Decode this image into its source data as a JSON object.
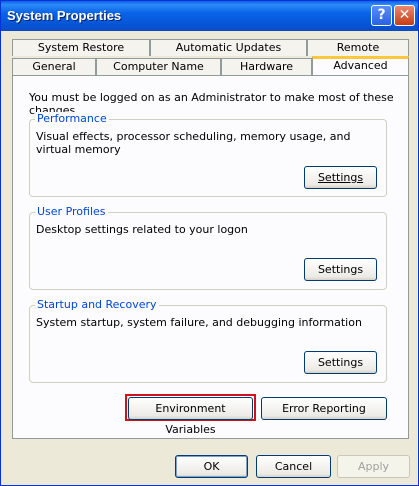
{
  "window": {
    "title": "System Properties",
    "help_glyph": "?",
    "close_glyph": "✕"
  },
  "tabs": {
    "row_back": [
      "System Restore",
      "Automatic Updates",
      "Remote"
    ],
    "row_front": [
      "General",
      "Computer Name",
      "Hardware",
      "Advanced"
    ],
    "active": "Advanced"
  },
  "content": {
    "notice": "You must be logged on as an Administrator to make most of these changes.",
    "groups": [
      {
        "title": "Performance",
        "description": "Visual effects, processor scheduling, memory usage, and virtual memory",
        "button": "Settings"
      },
      {
        "title": "User Profiles",
        "description": "Desktop settings related to your logon",
        "button": "Settings"
      },
      {
        "title": "Startup and Recovery",
        "description": "System startup, system failure, and debugging information",
        "button": "Settings"
      }
    ],
    "env_button": "Environment Variables",
    "error_button": "Error Reporting"
  },
  "footer": {
    "ok": "OK",
    "cancel": "Cancel",
    "apply": "Apply"
  },
  "colors": {
    "title_bar": "#0a5fe8",
    "group_title": "#0046d5",
    "highlight": "#d0101a",
    "tab_active_accent": "#ffc83c"
  }
}
